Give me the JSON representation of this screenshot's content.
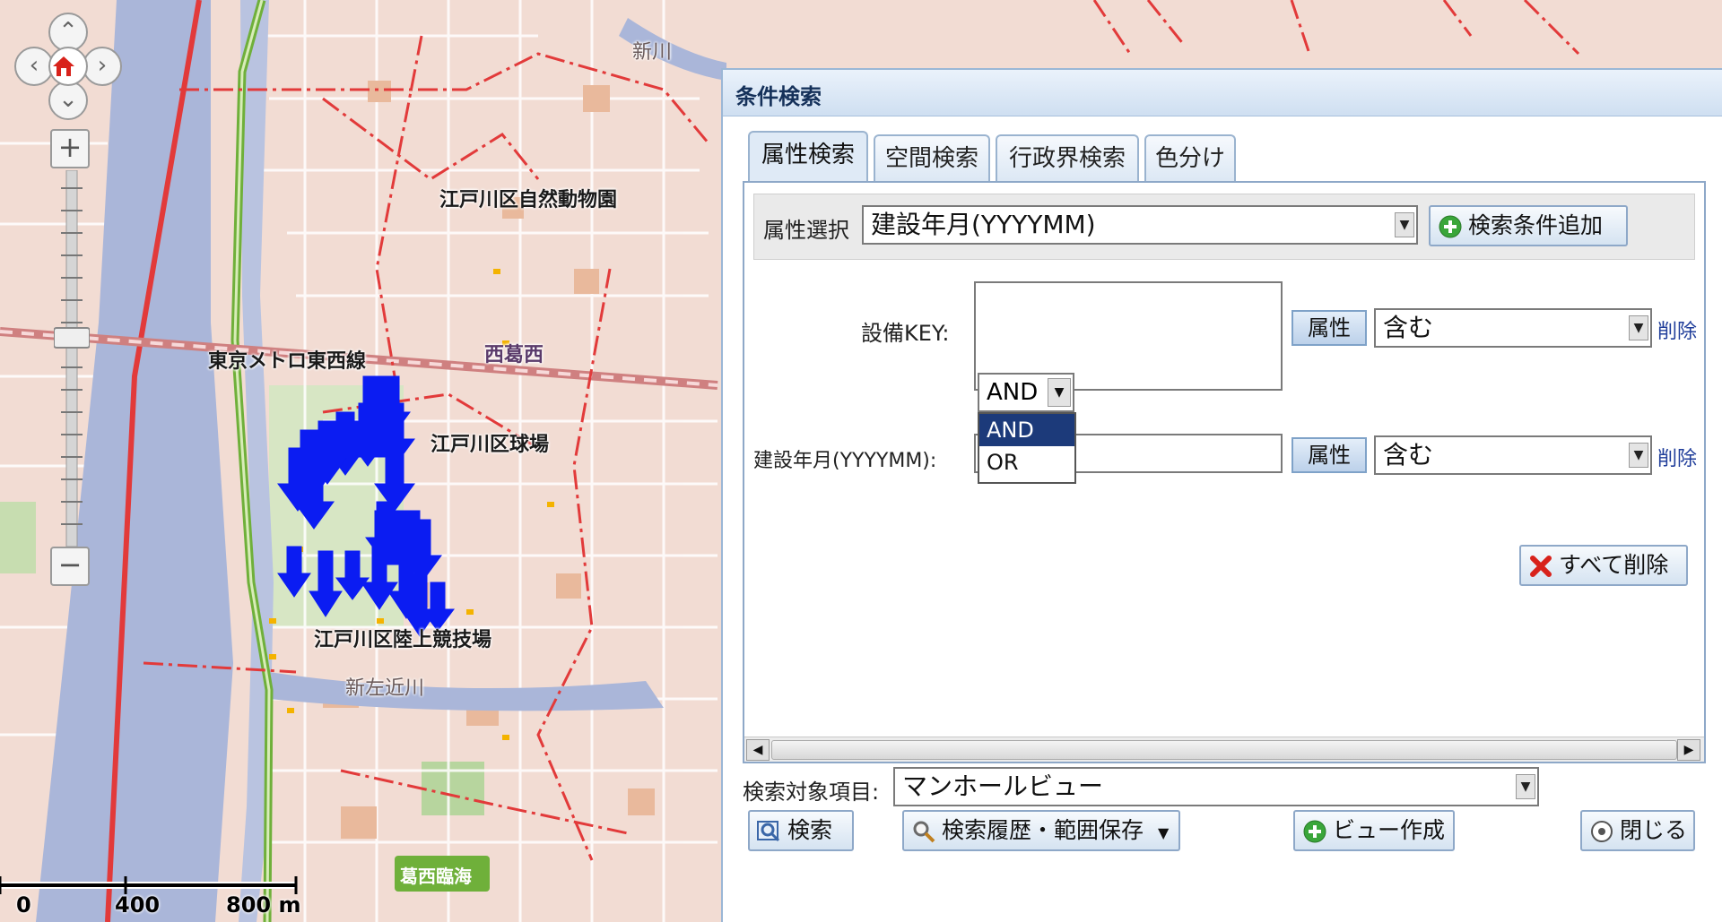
{
  "map": {
    "labels": {
      "shinkawa": "新川",
      "museum": "江戸川区自然動物園",
      "nishikasai": "西葛西",
      "metro_line": "東京メトロ東西線",
      "ballpark": "江戸川区球場",
      "stadium": "江戸川区陸上競技場",
      "shinsakongawa": "新左近川",
      "station_badge": "葛西臨海"
    },
    "scale": {
      "zero": "0",
      "mid": "400",
      "end": "800 m"
    },
    "colors": {
      "marker": "#0b1cf2",
      "river": "#aab6d9",
      "land": "#f2dcd3",
      "rail": "#e23a3a",
      "expressway": "#6fb03a"
    }
  },
  "dialog": {
    "title": "条件検索",
    "tabs": [
      {
        "label": "属性検索"
      },
      {
        "label": "空間検索"
      },
      {
        "label": "行政界検索"
      },
      {
        "label": "色分け"
      }
    ],
    "attr_select": {
      "label": "属性選択",
      "value": "建設年月(YYYYMM)",
      "add_button": "検索条件追加"
    },
    "conditions": [
      {
        "label": "設備KEY:",
        "value": "",
        "attr_button": "属性",
        "operator": "含む",
        "delete": "削除"
      },
      {
        "label": "建設年月(YYYYMM):",
        "value": "",
        "attr_button": "属性",
        "operator": "含む",
        "delete": "削除"
      }
    ],
    "logic": {
      "selected": "AND",
      "options": [
        "AND",
        "OR"
      ]
    },
    "delete_all_button": "すべて削除",
    "target": {
      "label": "検索対象項目:",
      "value": "マンホールビュー"
    },
    "footer": {
      "search": "検索",
      "history": "検索履歴・範囲保存",
      "create_view": "ビュー作成",
      "close": "閉じる"
    }
  }
}
